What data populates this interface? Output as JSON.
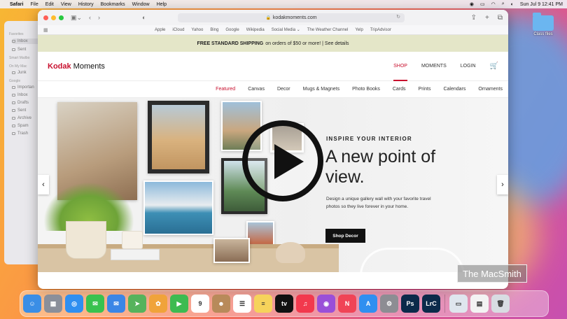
{
  "menubar": {
    "apple": "",
    "items": [
      "Safari",
      "File",
      "Edit",
      "View",
      "History",
      "Bookmarks",
      "Window",
      "Help"
    ],
    "clock": "Sun Jul 9  12:41 PM"
  },
  "desktop": {
    "folder_label": "Class files"
  },
  "mail_sidebar": {
    "sections": [
      {
        "title": "Favorites",
        "items": [
          "Inbox",
          "Sent"
        ]
      },
      {
        "title": "Smart Mailbo",
        "items": []
      },
      {
        "title": "On My Mac",
        "items": [
          "Junk"
        ]
      },
      {
        "title": "Google",
        "items": [
          "Importan",
          "Inbox",
          "Drafts",
          "Sent",
          "Archive",
          "Spam",
          "Trash"
        ]
      }
    ]
  },
  "safari": {
    "url": "kodakmoments.com",
    "favorites": [
      "Apple",
      "iCloud",
      "Yahoo",
      "Bing",
      "Google",
      "Wikipedia",
      "Social Media ⌄",
      "The Weather Channel",
      "Yelp",
      "TripAdvisor"
    ]
  },
  "site": {
    "promo_bold": "FREE STANDARD SHIPPING",
    "promo_text": "on orders of $50 or more! | See details",
    "logo_kodak": "Kodak",
    "logo_moments": " Moments",
    "nav": [
      "SHOP",
      "MOMENTS",
      "LOGIN"
    ],
    "categories": [
      "Featured",
      "Canvas",
      "Decor",
      "Mugs & Magnets",
      "Photo Books",
      "Cards",
      "Prints",
      "Calendars",
      "Ornaments"
    ],
    "hero": {
      "kicker": "INSPIRE YOUR INTERIOR",
      "title": "A new point of view.",
      "copy": "Design a unique gallery wall with your favorite travel photos so they live forever in your home.",
      "button": "Shop Decor"
    }
  },
  "watermark": "The MacSmith",
  "dock": [
    {
      "name": "finder",
      "color": "#3a8ee6",
      "glyph": "☺"
    },
    {
      "name": "launchpad",
      "color": "#8a8f9a",
      "glyph": "▦"
    },
    {
      "name": "safari",
      "color": "#2f8ff0",
      "glyph": "◎"
    },
    {
      "name": "messages",
      "color": "#39c24f",
      "glyph": "✉"
    },
    {
      "name": "mail",
      "color": "#3b86e6",
      "glyph": "✉"
    },
    {
      "name": "maps",
      "color": "#56b35c",
      "glyph": "➤"
    },
    {
      "name": "photos",
      "color": "#f0a33a",
      "glyph": "✿"
    },
    {
      "name": "facetime",
      "color": "#3dbb51",
      "glyph": "▶"
    },
    {
      "name": "calendar",
      "color": "#ffffff",
      "glyph": "9"
    },
    {
      "name": "contacts",
      "color": "#b88a5a",
      "glyph": "☻"
    },
    {
      "name": "reminders",
      "color": "#ffffff",
      "glyph": "☰"
    },
    {
      "name": "notes",
      "color": "#f6d35b",
      "glyph": "≡"
    },
    {
      "name": "apple-tv",
      "color": "#111111",
      "glyph": "tv"
    },
    {
      "name": "music",
      "color": "#f2394d",
      "glyph": "♫"
    },
    {
      "name": "podcasts",
      "color": "#9a4fd8",
      "glyph": "◉"
    },
    {
      "name": "news",
      "color": "#f04456",
      "glyph": "N"
    },
    {
      "name": "app-store",
      "color": "#2f8ff0",
      "glyph": "A"
    },
    {
      "name": "system-settings",
      "color": "#8d8d93",
      "glyph": "⚙"
    },
    {
      "name": "photoshop",
      "color": "#0b2a4a",
      "glyph": "Ps"
    },
    {
      "name": "lightroom-classic",
      "color": "#0b2a4a",
      "glyph": "LrC"
    },
    {
      "name": "preview",
      "color": "#dfe6ee",
      "glyph": "▭"
    },
    {
      "name": "document",
      "color": "#f3f3f3",
      "glyph": "▤"
    },
    {
      "name": "trash",
      "color": "#d8dce2",
      "glyph": "🗑"
    }
  ],
  "colors": {
    "brand_red": "#c8102e",
    "promo_bg": "#e4e6c8"
  }
}
